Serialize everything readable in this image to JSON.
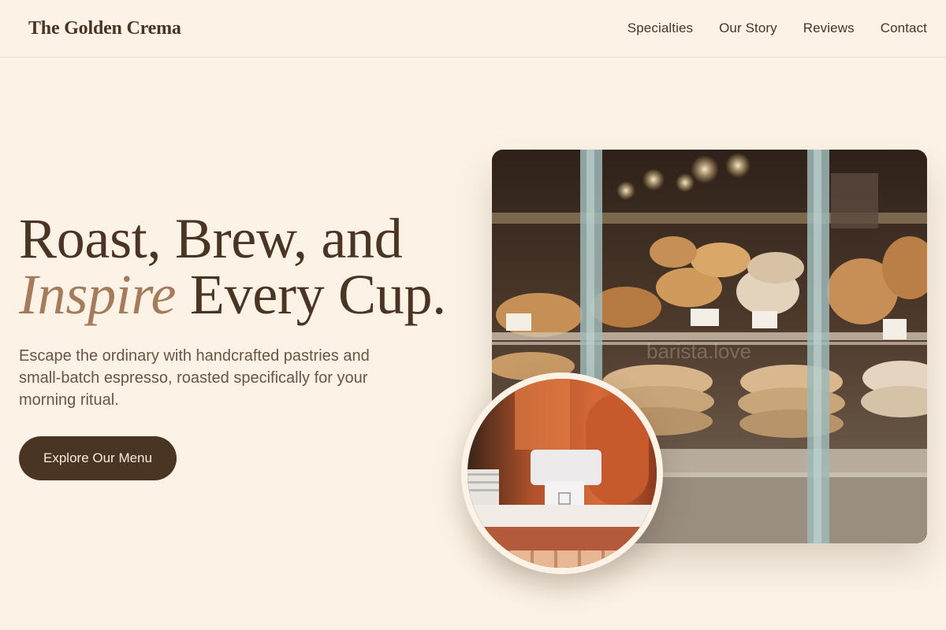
{
  "nav": {
    "logo": "The Golden Crema",
    "links": [
      "Specialties",
      "Our Story",
      "Reviews",
      "Contact"
    ]
  },
  "hero": {
    "title_line1": "Roast, Brew, and",
    "title_accent": "Inspire",
    "title_line2_rest": " Every Cup.",
    "description": "Escape the ordinary with handcrafted pastries and small-batch espresso, roasted specifically for your morning ritual.",
    "cta_label": "Explore Our Menu"
  },
  "images": {
    "main": "bakery-display-photo",
    "circle": "cafe-counter-photo",
    "watermark": "barista.love"
  },
  "colors": {
    "background": "#fcf3e6",
    "primary": "#4a3424",
    "accent": "#a67b5b",
    "button_text": "#f7ecdc"
  }
}
